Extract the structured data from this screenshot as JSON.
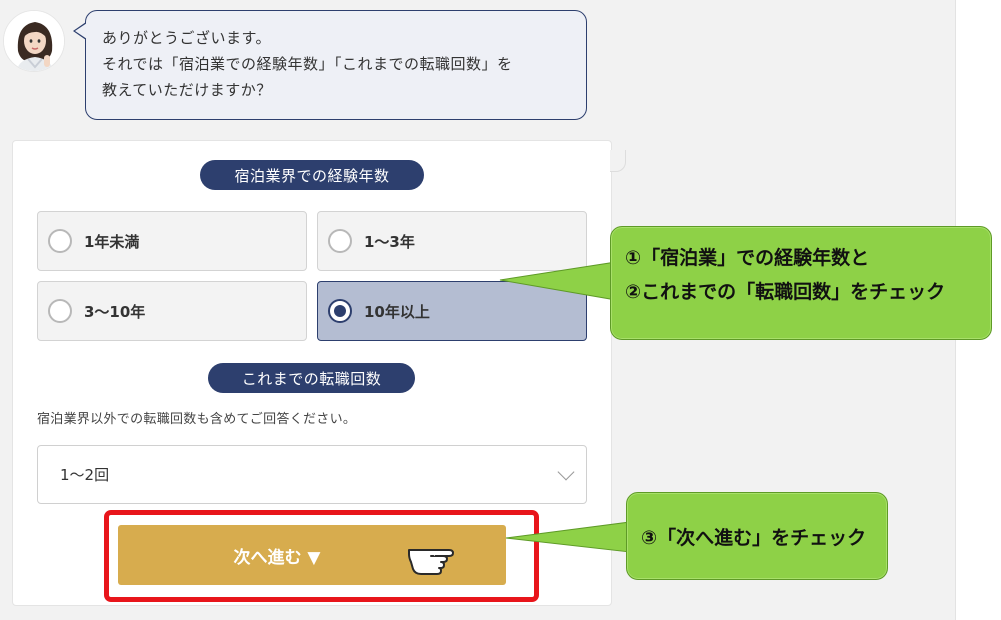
{
  "chat": {
    "avatar_icon": "assistant-avatar-icon",
    "message_lines": [
      "ありがとうございます。",
      "それでは「宿泊業での経験年数」「これまでの転職回数」を",
      "教えていただけますか？"
    ]
  },
  "form": {
    "experience": {
      "title": "宿泊業界での経験年数",
      "options": [
        {
          "label": "1年未満",
          "selected": false
        },
        {
          "label": "1〜3年",
          "selected": false
        },
        {
          "label": "3〜10年",
          "selected": false
        },
        {
          "label": "10年以上",
          "selected": true
        }
      ]
    },
    "job_changes": {
      "title": "これまでの転職回数",
      "helper": "宿泊業界以外での転職回数も含めてご回答ください。",
      "selected_value": "1〜2回"
    },
    "next_button": {
      "label": "次へ進む ▼"
    }
  },
  "annotations": {
    "callout_1_lines": [
      "①「宿泊業」での経験年数と",
      "②これまでの「転職回数」をチェック"
    ],
    "callout_2": "③「次へ進む」をチェック"
  },
  "colors": {
    "navy": "#2d3f6e",
    "gold": "#d7ac4e",
    "callout_green": "#8ed147",
    "highlight_red": "#e8151b"
  }
}
